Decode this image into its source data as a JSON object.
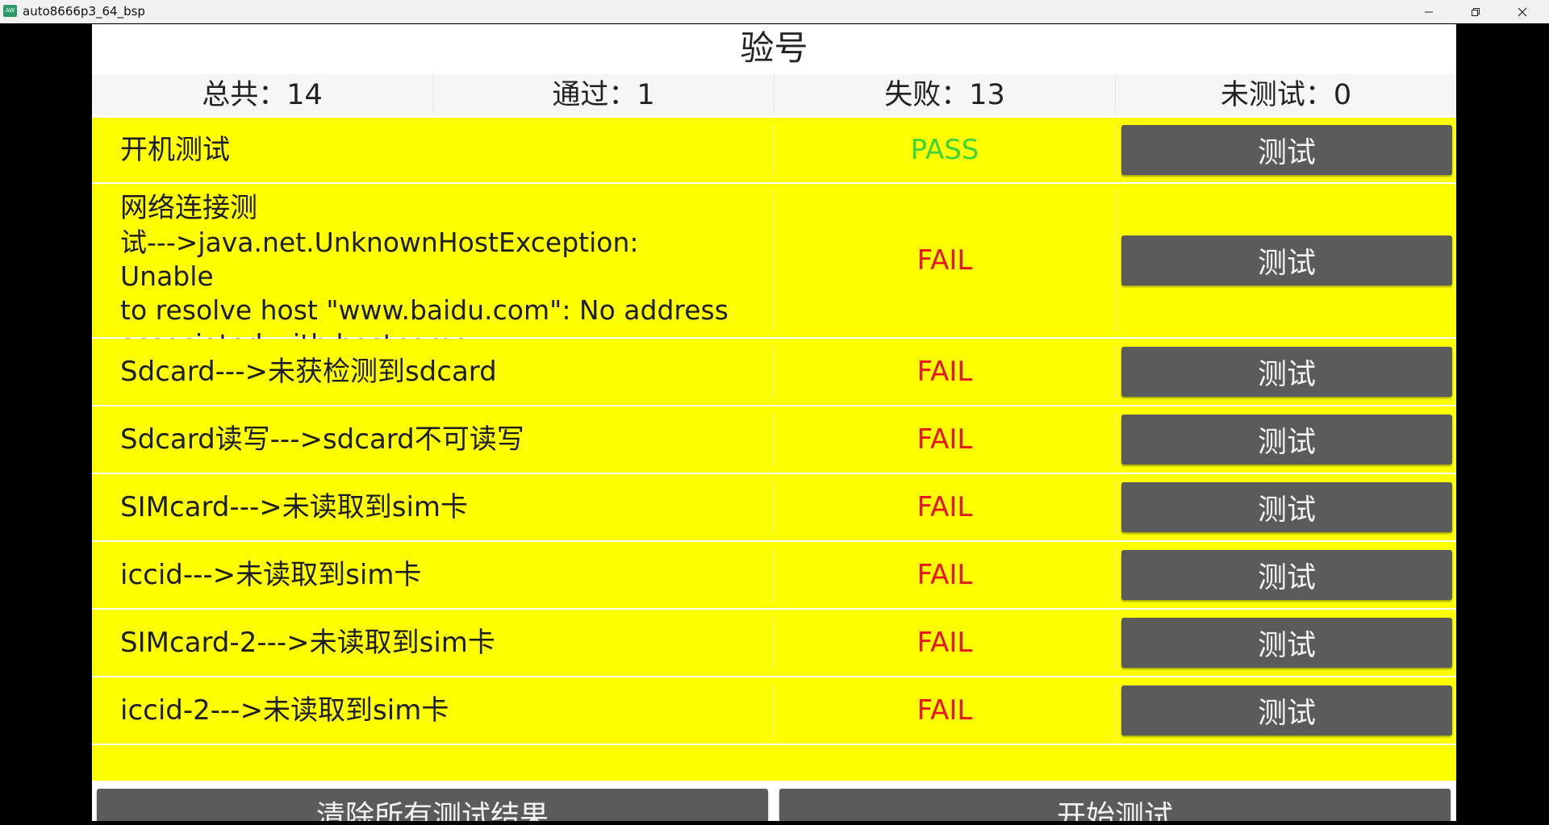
{
  "window": {
    "title": "auto8666p3_64_bsp",
    "app_icon_text": "AW",
    "minimize_icon": "minimize-icon",
    "maximize_icon": "restore-icon",
    "close_icon": "close-icon"
  },
  "page": {
    "title": "验号"
  },
  "summary": {
    "total": "总共：14",
    "passed": "通过：1",
    "failed": "失败：13",
    "untested": "未测试：0"
  },
  "tests": [
    {
      "name_lines": [
        "开机测试"
      ],
      "status": "PASS",
      "button": "测试"
    },
    {
      "name_lines": [
        "网络连接测",
        "试--->java.net.UnknownHostException: Unable",
        "to resolve host \"www.baidu.com\": No address",
        "associated with hostname"
      ],
      "status": "FAIL",
      "button": "测试"
    },
    {
      "name_lines": [
        "Sdcard--->未获检测到sdcard"
      ],
      "status": "FAIL",
      "button": "测试"
    },
    {
      "name_lines": [
        "Sdcard读写--->sdcard不可读写"
      ],
      "status": "FAIL",
      "button": "测试"
    },
    {
      "name_lines": [
        "SIMcard--->未读取到sim卡"
      ],
      "status": "FAIL",
      "button": "测试"
    },
    {
      "name_lines": [
        "iccid--->未读取到sim卡"
      ],
      "status": "FAIL",
      "button": "测试"
    },
    {
      "name_lines": [
        "SIMcard-2--->未读取到sim卡"
      ],
      "status": "FAIL",
      "button": "测试"
    },
    {
      "name_lines": [
        "iccid-2--->未读取到sim卡"
      ],
      "status": "FAIL",
      "button": "测试"
    }
  ],
  "colors": {
    "row_background": "#ffff00",
    "pass": "#3ed43b",
    "fail": "#e8151c",
    "button": "#5b5b5b",
    "button_text": "#f3f3f3"
  },
  "actions": {
    "clear_label": "清除所有测试结果",
    "start_label": "开始测试"
  }
}
